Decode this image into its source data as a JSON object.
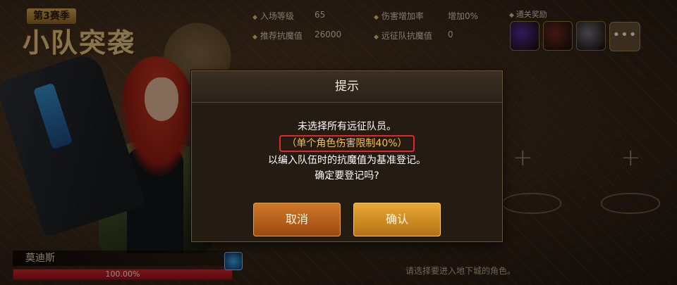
{
  "event": {
    "season": "第3赛季",
    "title": "小队突袭"
  },
  "stats": {
    "entry_level_label": "入场等级",
    "entry_level_value": "65",
    "recommended_anti_label": "推荐抗魔值",
    "recommended_anti_value": "26000",
    "damage_bonus_label": "伤害增加率",
    "damage_bonus_value": "增加0%",
    "expedition_anti_label": "远征队抗魔值",
    "expedition_anti_value": "0"
  },
  "rewards": {
    "label": "通关奖励",
    "more_label": "•••",
    "colors": [
      "#5b2fa8",
      "#7a2a22",
      "#7a7a86"
    ]
  },
  "character": {
    "name": "莫迪斯",
    "hp_text": "100.00%",
    "hp_fraction": 1.0
  },
  "hint": "请选择要进入地下城的角色。",
  "dialog": {
    "title": "提示",
    "line1": "未选择所有远征队员。",
    "line2": "（单个角色伤害限制40%）",
    "line3": "以编入队伍时的抗魔值为基准登记。",
    "line4": "确定要登记吗?",
    "cancel_label": "取消",
    "confirm_label": "确认"
  },
  "slots": {
    "plus": "+"
  },
  "colors": {
    "hp": "#e6262b",
    "highlight_border": "#e2262b",
    "highlight_text": "#f6c03b"
  }
}
